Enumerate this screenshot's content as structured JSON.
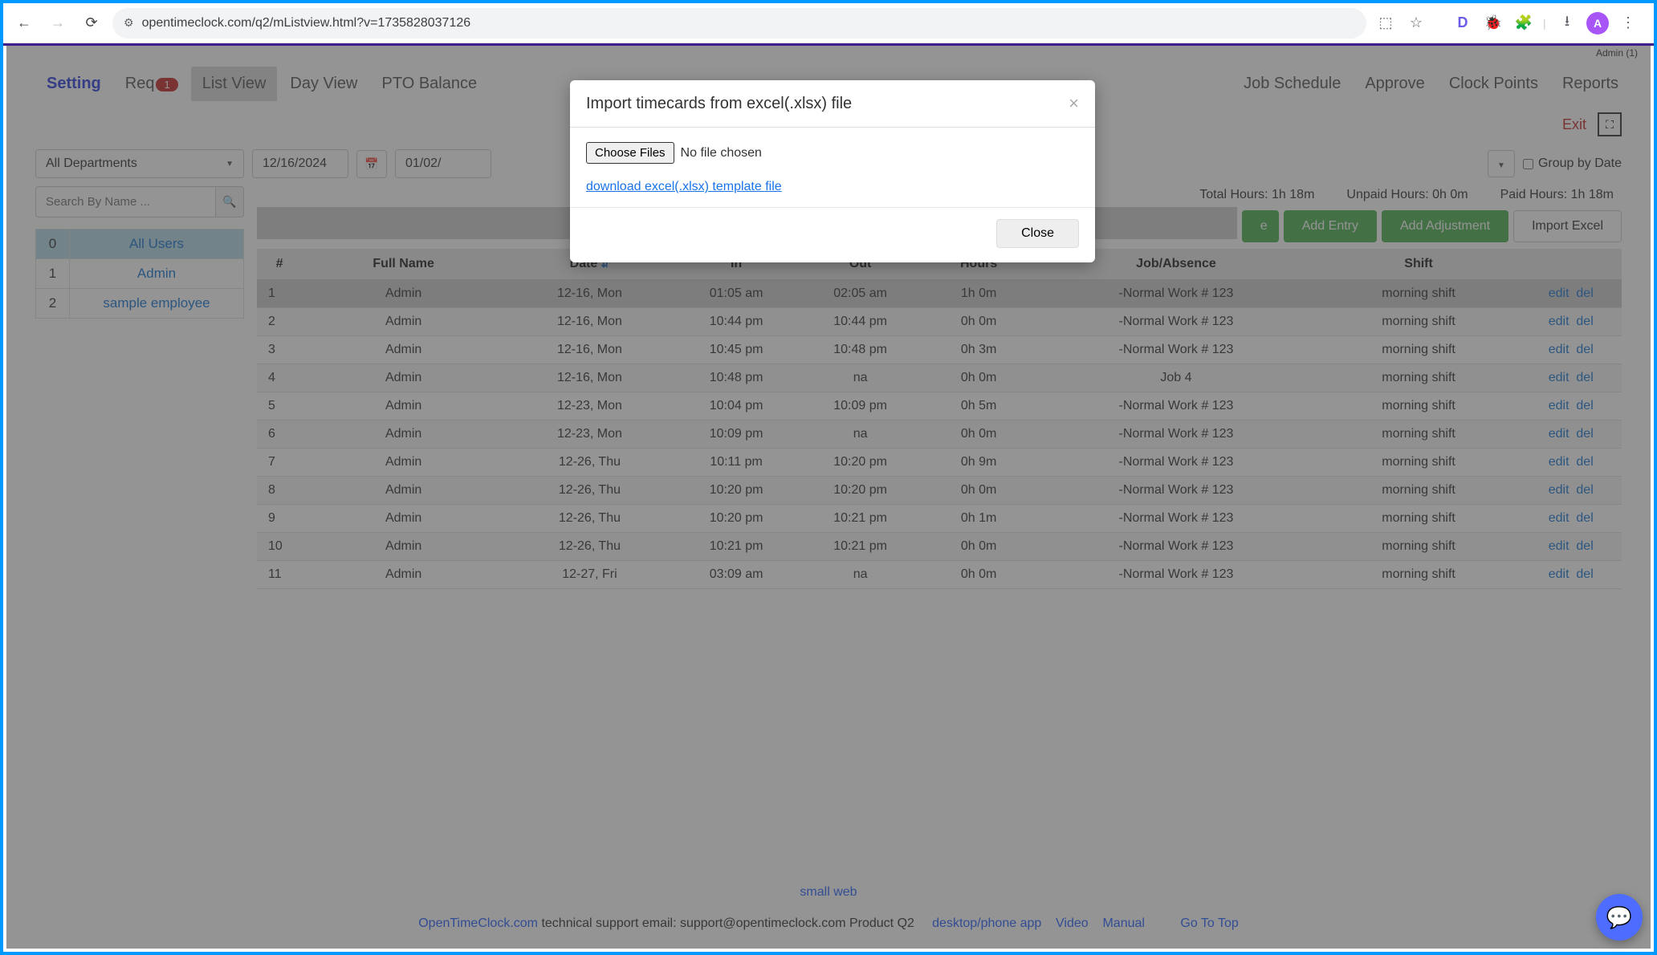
{
  "browser": {
    "url": "opentimeclock.com/q2/mListview.html?v=1735828037126",
    "avatar_letter": "A"
  },
  "admin_label": "Admin (1)",
  "tabs": {
    "setting": "Setting",
    "req": "Req",
    "req_badge": "1",
    "list_view": "List View",
    "day_view": "Day View",
    "pto_balance": "PTO Balance",
    "job_schedule": "Job Schedule",
    "approve": "Approve",
    "clock_points": "Clock Points",
    "reports": "Reports"
  },
  "exit_label": "Exit",
  "filters": {
    "department": "All Departments",
    "date_from": "12/16/2024",
    "date_to": "01/02/",
    "group_by_date": "Group by Date",
    "search_placeholder": "Search By Name ..."
  },
  "users": [
    {
      "id": "0",
      "name": "All Users"
    },
    {
      "id": "1",
      "name": "Admin"
    },
    {
      "id": "2",
      "name": "sample employee"
    }
  ],
  "hours_summary": {
    "total": "Total Hours: 1h 18m",
    "unpaid": "Unpaid Hours: 0h 0m",
    "paid": "Paid Hours: 1h 18m"
  },
  "buttons": {
    "add_entry": "Add Entry",
    "add_adjustment": "Add Adjustment",
    "import_excel": "Import Excel"
  },
  "table": {
    "headers": {
      "num": "#",
      "full_name": "Full Name",
      "date": "Date",
      "in": "In",
      "out": "Out",
      "hours": "Hours",
      "job": "Job/Absence",
      "shift": "Shift"
    },
    "edit": "edit",
    "del": "del",
    "rows": [
      {
        "n": "1",
        "name": "Admin",
        "date": "12-16, Mon",
        "in": "01:05 am",
        "out": "02:05 am",
        "out_na": false,
        "hours": "1h 0m",
        "job": "-Normal Work # 123",
        "shift": "morning shift"
      },
      {
        "n": "2",
        "name": "Admin",
        "date": "12-16, Mon",
        "in": "10:44 pm",
        "out": "10:44 pm",
        "out_na": false,
        "hours": "0h 0m",
        "job": "-Normal Work # 123",
        "shift": "morning shift"
      },
      {
        "n": "3",
        "name": "Admin",
        "date": "12-16, Mon",
        "in": "10:45 pm",
        "out": "10:48 pm",
        "out_na": false,
        "hours": "0h 3m",
        "job": "-Normal Work # 123",
        "shift": "morning shift"
      },
      {
        "n": "4",
        "name": "Admin",
        "date": "12-16, Mon",
        "in": "10:48 pm",
        "out": "na",
        "out_na": true,
        "hours": "0h 0m",
        "job": "Job 4",
        "shift": "morning shift"
      },
      {
        "n": "5",
        "name": "Admin",
        "date": "12-23, Mon",
        "in": "10:04 pm",
        "out": "10:09 pm",
        "out_na": false,
        "hours": "0h 5m",
        "job": "-Normal Work # 123",
        "shift": "morning shift"
      },
      {
        "n": "6",
        "name": "Admin",
        "date": "12-23, Mon",
        "in": "10:09 pm",
        "out": "na",
        "out_na": true,
        "hours": "0h 0m",
        "job": "-Normal Work # 123",
        "shift": "morning shift"
      },
      {
        "n": "7",
        "name": "Admin",
        "date": "12-26, Thu",
        "in": "10:11 pm",
        "out": "10:20 pm",
        "out_na": false,
        "hours": "0h 9m",
        "job": "-Normal Work # 123",
        "shift": "morning shift"
      },
      {
        "n": "8",
        "name": "Admin",
        "date": "12-26, Thu",
        "in": "10:20 pm",
        "out": "10:20 pm",
        "out_na": false,
        "hours": "0h 0m",
        "job": "-Normal Work # 123",
        "shift": "morning shift"
      },
      {
        "n": "9",
        "name": "Admin",
        "date": "12-26, Thu",
        "in": "10:20 pm",
        "out": "10:21 pm",
        "out_na": false,
        "hours": "0h 1m",
        "job": "-Normal Work # 123",
        "shift": "morning shift"
      },
      {
        "n": "10",
        "name": "Admin",
        "date": "12-26, Thu",
        "in": "10:21 pm",
        "out": "10:21 pm",
        "out_na": false,
        "hours": "0h 0m",
        "job": "-Normal Work # 123",
        "shift": "morning shift"
      },
      {
        "n": "11",
        "name": "Admin",
        "date": "12-27, Fri",
        "in": "03:09 am",
        "out": "na",
        "out_na": true,
        "hours": "0h 0m",
        "job": "-Normal Work # 123",
        "shift": "morning shift"
      }
    ]
  },
  "footer": {
    "small_web": "small web",
    "brand": "OpenTimeClock.com",
    "support": " technical support email: support@opentimeclock.com Product Q2",
    "desktop": "desktop/phone app",
    "video": "Video",
    "manual": "Manual",
    "goto": "Go To Top"
  },
  "modal": {
    "title": "Import timecards from excel(.xlsx) file",
    "choose": "Choose Files",
    "nofile": "No file chosen",
    "download": "download excel(.xlsx) template file",
    "close": "Close"
  }
}
